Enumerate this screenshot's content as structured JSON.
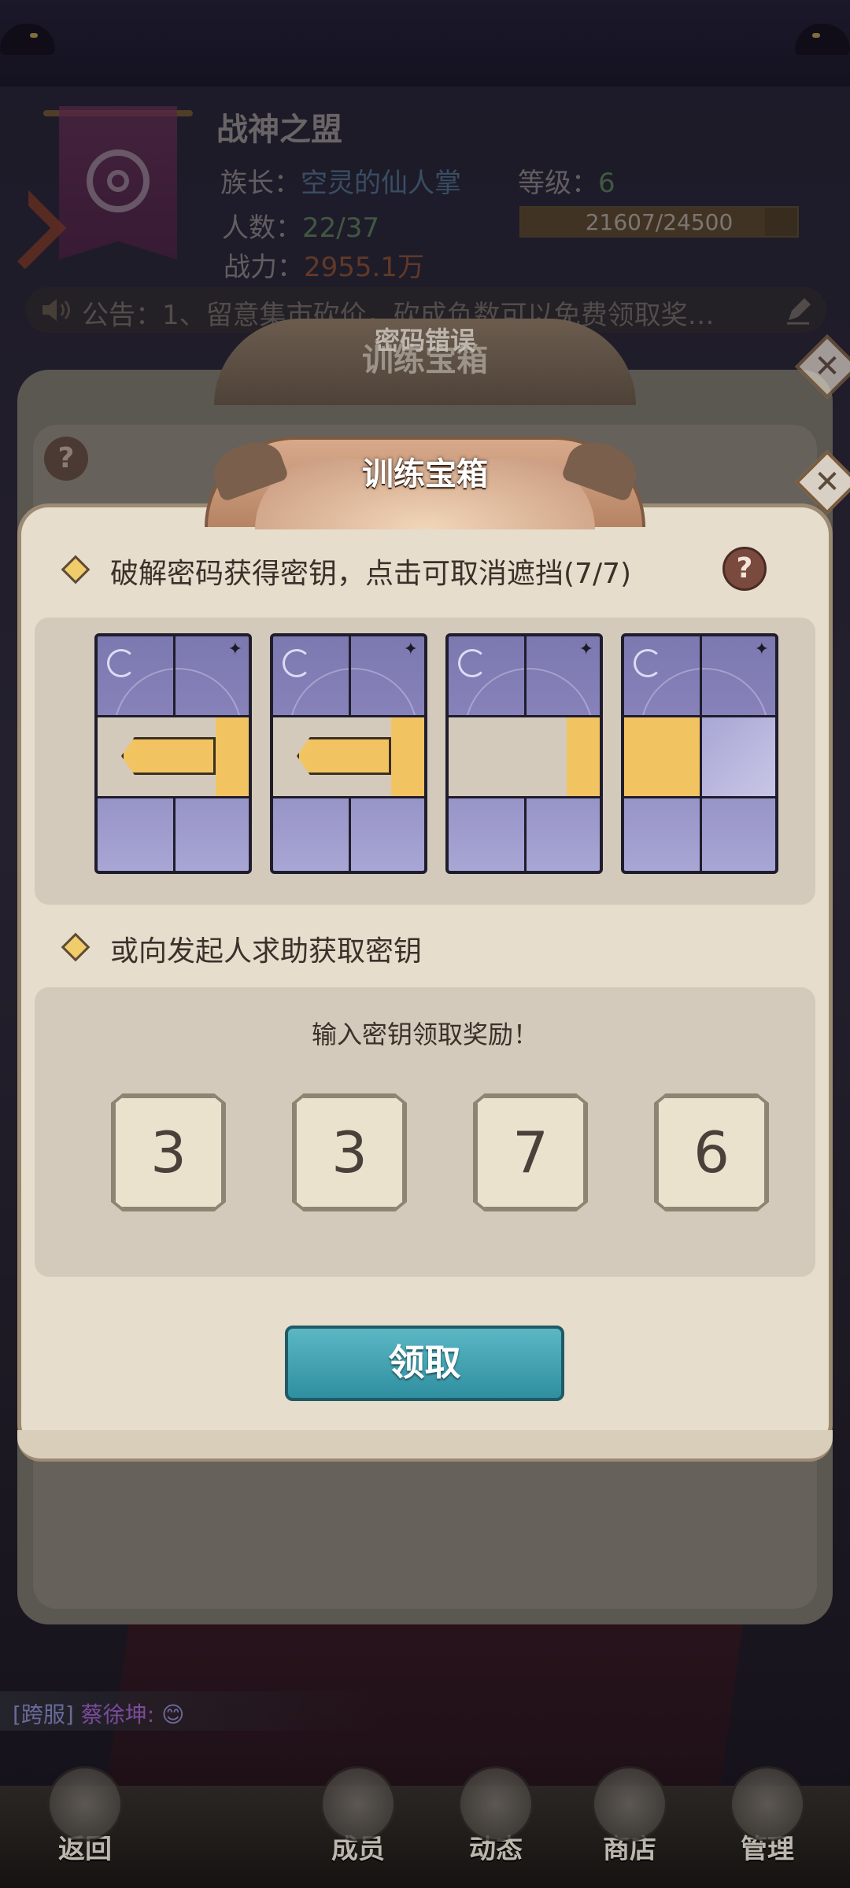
{
  "header": {
    "guild_name": "战神之盟",
    "leader_label": "族长：",
    "leader_name": "空灵的仙人掌",
    "level_label": "等级：",
    "level_value": "6",
    "members_label": "人数：",
    "members_value": "22/37",
    "power_label": "战力：",
    "power_value": "2955.1万",
    "xp_text": "21607/24500",
    "xp_fraction": 0.882,
    "notice_text": "公告：1、留意集市砍价，砍成负数可以免费领取奖…"
  },
  "back_dialog": {
    "error_text": "密码错误",
    "title": "训练宝箱",
    "close_symbol": "✕",
    "help_symbol": "?"
  },
  "dialog": {
    "title": "训练宝箱",
    "close_symbol": "✕",
    "help_symbol": "?",
    "section1_label": "破解密码获得密钥，点击可取消遮挡(7/7)",
    "section2_label": "或向发起人求助获取密钥",
    "input_prompt": "输入密钥领取奖励！",
    "key_digits": [
      "3",
      "3",
      "7",
      "6"
    ],
    "claim_button": "领取"
  },
  "chat": {
    "tag": "[跨服]",
    "name": "蔡徐坤:",
    "emoji": "😊"
  },
  "nav": {
    "back": "返回",
    "members": "成员",
    "activity": "动态",
    "shop": "商店",
    "manage": "管理"
  },
  "colors": {
    "accent_teal": "#3a9fb0",
    "gold": "#f2c461",
    "tile_purple": "#8a86bd",
    "paper": "#e6ddcd"
  }
}
